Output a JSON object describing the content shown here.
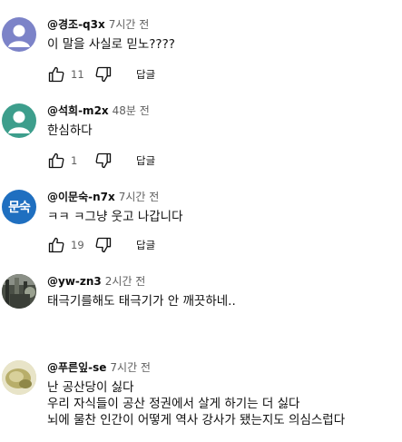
{
  "comments": [
    {
      "author": "@경조-q3x",
      "time": "7시간 전",
      "lines": [
        "이 말을 사실로 믿노????"
      ],
      "likes": "11",
      "reply_label": "답글",
      "avatar": {
        "type": "person",
        "bg": "#7c83c8"
      }
    },
    {
      "author": "@석희-m2x",
      "time": "48분 전",
      "lines": [
        "한심하다"
      ],
      "likes": "1",
      "reply_label": "답글",
      "avatar": {
        "type": "person",
        "bg": "#3d9e8c"
      }
    },
    {
      "author": "@이문숙-n7x",
      "time": "7시간 전",
      "lines": [
        "ㅋㅋ ㅋ그냥 웃고 나갑니다"
      ],
      "likes": "19",
      "reply_label": "답글",
      "avatar": {
        "type": "text",
        "text": "문숙",
        "bg": "#1f6fc0"
      }
    },
    {
      "author": "@yw-zn3",
      "time": "2시간 전",
      "lines": [
        "태극기를해도 태극기가 안 깨끗하네.."
      ],
      "avatar": {
        "type": "photo",
        "bg": "#4a4f46"
      }
    },
    {
      "author": "@푸른잎-se",
      "time": "7시간 전",
      "lines": [
        "난 공산당이 싫다",
        "우리 자식들이 공산 정권에서 살게 하기는 더 싫다",
        "뇌에 물찬 인간이 어떻게 역사 강사가 됐는지도 의심스럽다"
      ],
      "avatar": {
        "type": "photo",
        "bg": "#cfc99a"
      }
    }
  ]
}
